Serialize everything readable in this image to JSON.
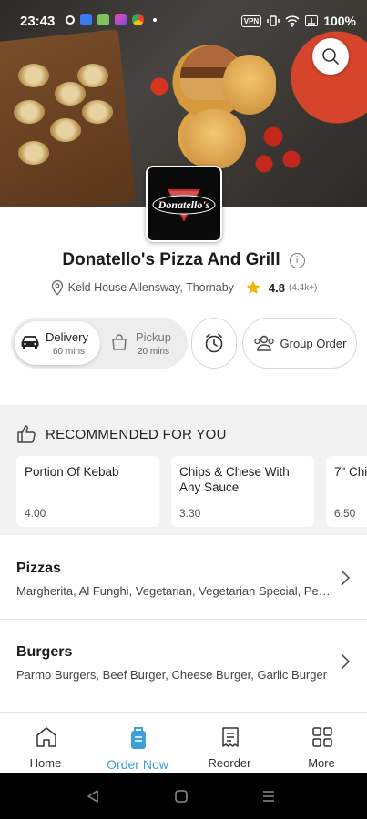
{
  "status_bar": {
    "time": "23:43",
    "battery": "100%",
    "vpn": "VPN"
  },
  "restaurant": {
    "name": "Donatello's Pizza And Grill",
    "logo_text": "Donatello's",
    "address": "Keld House Allensway, Thornaby",
    "rating": "4.8",
    "rating_count": "(4.4k+)"
  },
  "order_modes": {
    "delivery": {
      "label": "Delivery",
      "time": "60 mins"
    },
    "pickup": {
      "label": "Pickup",
      "time": "20 mins"
    },
    "group_order": "Group Order"
  },
  "recommended": {
    "title": "RECOMMENDED FOR YOU",
    "items": [
      {
        "name": "Portion Of Kebab",
        "price": "4.00"
      },
      {
        "name": "Chips & Chese With Any Sauce",
        "price": "3.30"
      },
      {
        "name": "7\" Chi",
        "price": "6.50"
      }
    ]
  },
  "categories": [
    {
      "title": "Pizzas",
      "desc": "Margherita, Al Funghi, Vegetarian, Vegetarian Special, Pepperoni"
    },
    {
      "title": "Burgers",
      "desc": "Parmo Burgers, Beef Burger, Cheese Burger, Garlic Burger"
    }
  ],
  "bottom_nav": {
    "home": "Home",
    "order_now": "Order Now",
    "reorder": "Reorder",
    "more": "More"
  },
  "colors": {
    "accent": "#3b9fd8",
    "star": "#f2b400"
  }
}
